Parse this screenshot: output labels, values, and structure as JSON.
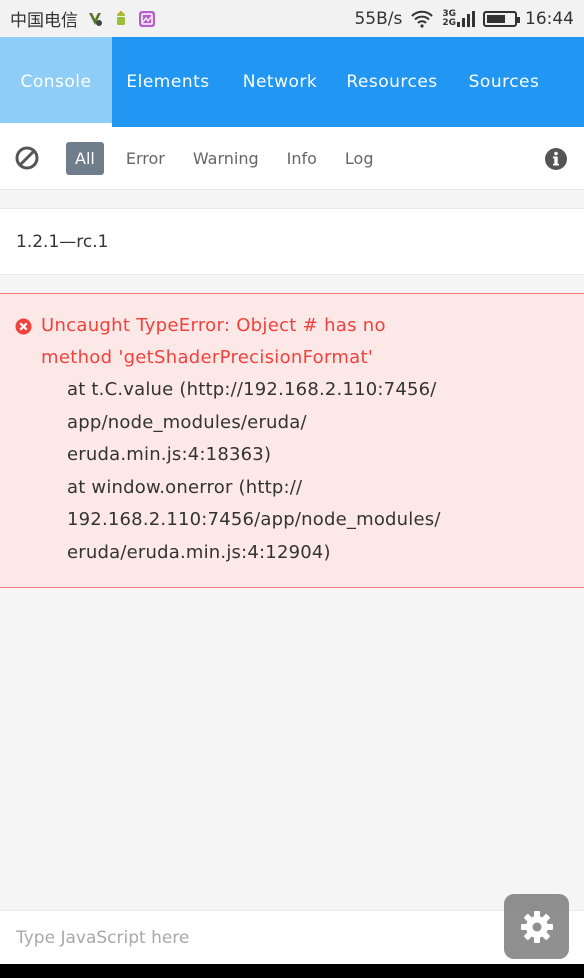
{
  "status_bar": {
    "carrier": "中国电信",
    "speed": "55B/s",
    "net_top": "3G",
    "net_bottom": "2G",
    "time": "16:44"
  },
  "tabs": [
    {
      "label": "Console",
      "active": true
    },
    {
      "label": "Elements",
      "active": false
    },
    {
      "label": "Network",
      "active": false
    },
    {
      "label": "Resources",
      "active": false
    },
    {
      "label": "Sources",
      "active": false
    }
  ],
  "toolbar": {
    "clear_icon": "block-icon",
    "filters": [
      "All",
      "Error",
      "Warning",
      "Info",
      "Log"
    ],
    "active_filter": "All",
    "info_icon": "info-icon"
  },
  "logs": {
    "info_entry": "1.2.1—rc.1",
    "error_entry": {
      "message_line1": "Uncaught TypeError: Object # has no",
      "message_line2": "method 'getShaderPrecisionFormat'",
      "stack": [
        "at t.C.value (http://192.168.2.110:7456/",
        "app/node_modules/eruda/",
        "eruda.min.js:4:18363)",
        "at window.onerror (http://",
        "192.168.2.110:7456/app/node_modules/",
        "eruda/eruda.min.js:4:12904)"
      ]
    }
  },
  "js_input": {
    "placeholder": "Type JavaScript here"
  },
  "colors": {
    "accent": "#2196f3",
    "active_tab": "#8ecdf6",
    "error_text": "#f0413c",
    "error_bg": "#fde8e8",
    "filter_active_bg": "#707d8b"
  }
}
